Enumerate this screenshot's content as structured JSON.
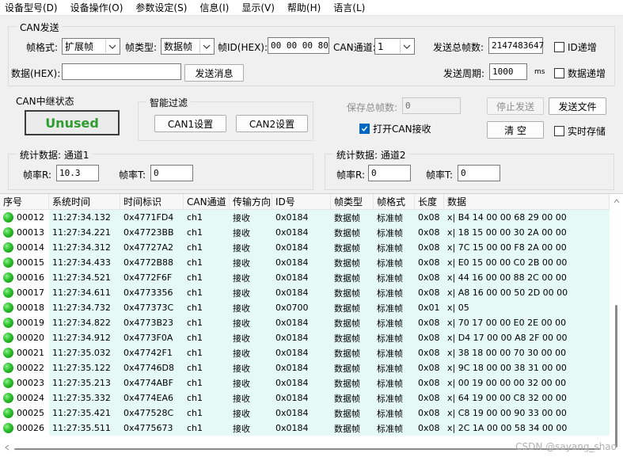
{
  "menu": [
    "设备型号(D)",
    "设备操作(O)",
    "参数设定(S)",
    "信息(I)",
    "显示(V)",
    "帮助(H)",
    "语言(L)"
  ],
  "can_send": {
    "title": "CAN发送",
    "frame_format_label": "帧格式:",
    "frame_format_value": "扩展帧",
    "frame_type_label": "帧类型:",
    "frame_type_value": "数据帧",
    "frame_id_label": "帧ID(HEX):",
    "frame_id_value": "00 00 00 80",
    "channel_label": "CAN通道:",
    "channel_value": "1",
    "total_frames_label": "发送总帧数:",
    "total_frames_value": "2147483647",
    "id_increment_label": "ID递增",
    "data_label": "数据(HEX):",
    "data_value": "",
    "send_button": "发送消息",
    "period_label": "发送周期:",
    "period_value": "1000",
    "period_unit": "ms",
    "data_increment_label": "数据递增"
  },
  "relay": {
    "title": "CAN中继状态",
    "status": "Unused",
    "status_color": "#2e9c2e"
  },
  "filter": {
    "title": "智能过滤",
    "can1_button": "CAN1设置",
    "can2_button": "CAN2设置"
  },
  "controls": {
    "saved_frames_label": "保存总帧数:",
    "saved_frames_value": "0",
    "stop_send_button": "停止发送",
    "send_file_button": "发送文件",
    "open_can_receive_label": "打开CAN接收",
    "open_can_receive_checked": true,
    "clear_button": "清 空",
    "realtime_save_label": "实时存储"
  },
  "stats1": {
    "title": "统计数据: 通道1",
    "rate_r_label": "帧率R:",
    "rate_r_value": "10.3",
    "rate_t_label": "帧率T:",
    "rate_t_value": "0"
  },
  "stats2": {
    "title": "统计数据: 通道2",
    "rate_r_label": "帧率R:",
    "rate_r_value": "0",
    "rate_t_label": "帧率T:",
    "rate_t_value": "0"
  },
  "table": {
    "columns": [
      "序号",
      "系统时间",
      "时间标识",
      "CAN通道",
      "传输方向",
      "ID号",
      "帧类型",
      "帧格式",
      "长度",
      "数据"
    ],
    "rows": [
      [
        "00012",
        "11:27:34.132",
        "0x4771FD4",
        "ch1",
        "接收",
        "0x0184",
        "数据帧",
        "标准帧",
        "0x08",
        "x| B4 14 00 00 68 29 00 00"
      ],
      [
        "00013",
        "11:27:34.221",
        "0x47723BB",
        "ch1",
        "接收",
        "0x0184",
        "数据帧",
        "标准帧",
        "0x08",
        "x| 18 15 00 00 30 2A 00 00"
      ],
      [
        "00014",
        "11:27:34.312",
        "0x47727A2",
        "ch1",
        "接收",
        "0x0184",
        "数据帧",
        "标准帧",
        "0x08",
        "x| 7C 15 00 00 F8 2A 00 00"
      ],
      [
        "00015",
        "11:27:34.433",
        "0x4772B88",
        "ch1",
        "接收",
        "0x0184",
        "数据帧",
        "标准帧",
        "0x08",
        "x| E0 15 00 00 C0 2B 00 00"
      ],
      [
        "00016",
        "11:27:34.521",
        "0x4772F6F",
        "ch1",
        "接收",
        "0x0184",
        "数据帧",
        "标准帧",
        "0x08",
        "x| 44 16 00 00 88 2C 00 00"
      ],
      [
        "00017",
        "11:27:34.611",
        "0x4773356",
        "ch1",
        "接收",
        "0x0184",
        "数据帧",
        "标准帧",
        "0x08",
        "x| A8 16 00 00 50 2D 00 00"
      ],
      [
        "00018",
        "11:27:34.732",
        "0x477373C",
        "ch1",
        "接收",
        "0x0700",
        "数据帧",
        "标准帧",
        "0x01",
        "x| 05"
      ],
      [
        "00019",
        "11:27:34.822",
        "0x4773B23",
        "ch1",
        "接收",
        "0x0184",
        "数据帧",
        "标准帧",
        "0x08",
        "x| 70 17 00 00 E0 2E 00 00"
      ],
      [
        "00020",
        "11:27:34.912",
        "0x4773F0A",
        "ch1",
        "接收",
        "0x0184",
        "数据帧",
        "标准帧",
        "0x08",
        "x| D4 17 00 00 A8 2F 00 00"
      ],
      [
        "00021",
        "11:27:35.032",
        "0x47742F1",
        "ch1",
        "接收",
        "0x0184",
        "数据帧",
        "标准帧",
        "0x08",
        "x| 38 18 00 00 70 30 00 00"
      ],
      [
        "00022",
        "11:27:35.122",
        "0x47746D8",
        "ch1",
        "接收",
        "0x0184",
        "数据帧",
        "标准帧",
        "0x08",
        "x| 9C 18 00 00 38 31 00 00"
      ],
      [
        "00023",
        "11:27:35.213",
        "0x4774ABF",
        "ch1",
        "接收",
        "0x0184",
        "数据帧",
        "标准帧",
        "0x08",
        "x| 00 19 00 00 00 32 00 00"
      ],
      [
        "00024",
        "11:27:35.332",
        "0x4774EA6",
        "ch1",
        "接收",
        "0x0184",
        "数据帧",
        "标准帧",
        "0x08",
        "x| 64 19 00 00 C8 32 00 00"
      ],
      [
        "00025",
        "11:27:35.421",
        "0x477528C",
        "ch1",
        "接收",
        "0x0184",
        "数据帧",
        "标准帧",
        "0x08",
        "x| C8 19 00 00 90 33 00 00"
      ],
      [
        "00026",
        "11:27:35.511",
        "0x4775673",
        "ch1",
        "接收",
        "0x0184",
        "数据帧",
        "标准帧",
        "0x08",
        "x| 2C 1A 00 00 58 34 00 00"
      ]
    ]
  },
  "watermark": "CSDN @sayang_shao",
  "row_status_icon": "green-led-icon"
}
